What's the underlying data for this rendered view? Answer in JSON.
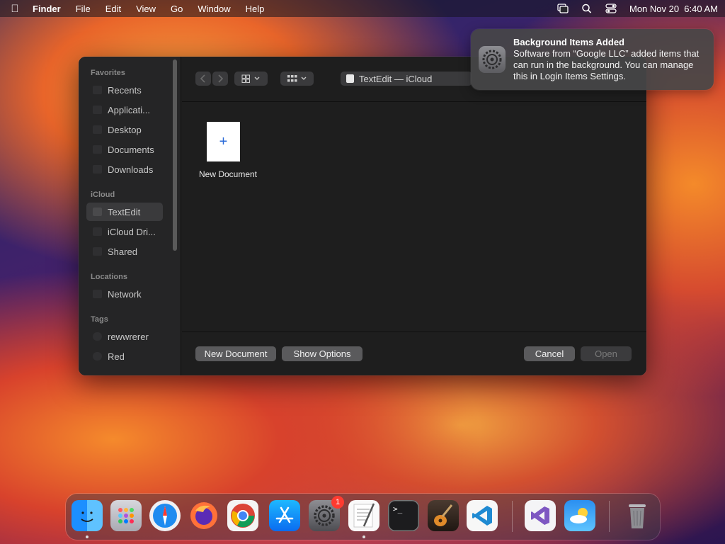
{
  "menubar": {
    "app_name": "Finder",
    "items": [
      "File",
      "Edit",
      "View",
      "Go",
      "Window",
      "Help"
    ],
    "clock": "Mon Nov 20  6:40 AM",
    "icons": [
      "apple-logo-icon",
      "screen-mirroring-icon",
      "search-icon",
      "control-center-icon"
    ]
  },
  "dialog": {
    "sidebar": {
      "favorites_label": "Favorites",
      "favorites": [
        "Recents",
        "Applicati...",
        "Desktop",
        "Documents",
        "Downloads"
      ],
      "icloud_label": "iCloud",
      "icloud": [
        "TextEdit",
        "iCloud Dri...",
        "Shared"
      ],
      "locations_label": "Locations",
      "locations": [
        "Network"
      ],
      "tags_label": "Tags",
      "tags": [
        "rewwrerer",
        "Red"
      ]
    },
    "location": "TextEdit — iCloud",
    "new_document_tile": "New Document",
    "buttons": {
      "new_document": "New Document",
      "show_options": "Show Options",
      "cancel": "Cancel",
      "open": "Open"
    }
  },
  "notification": {
    "title": "Background Items Added",
    "body": "Software from “Google LLC” added items that can run in the background. You can manage this in Login Items Settings."
  },
  "dock": {
    "apps": [
      "Finder",
      "Launchpad",
      "Safari",
      "Firefox",
      "Chrome",
      "App Store",
      "System Settings",
      "TextEdit",
      "Terminal",
      "GarageBand",
      "VS Code",
      "Visual Studio",
      "Weather",
      "Trash"
    ],
    "system_settings_badge": "1"
  }
}
